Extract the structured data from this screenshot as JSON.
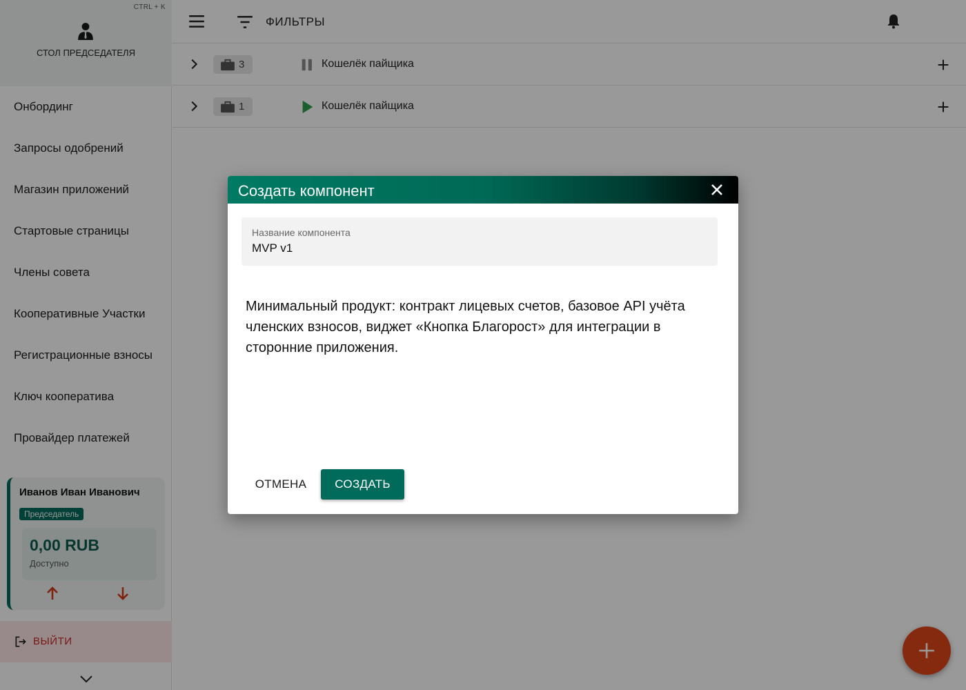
{
  "sidebar": {
    "shortcut": "CTRL + K",
    "title": "СТОЛ ПРЕДСЕДАТЕЛЯ",
    "menu": [
      {
        "label": "Онбординг"
      },
      {
        "label": "Запросы одобрений"
      },
      {
        "label": "Магазин приложений"
      },
      {
        "label": "Стартовые страницы"
      },
      {
        "label": "Члены совета"
      },
      {
        "label": "Кооперативные Участки"
      },
      {
        "label": "Регистрационные взносы"
      },
      {
        "label": "Ключ кооператива"
      },
      {
        "label": "Провайдер платежей"
      }
    ],
    "user": {
      "name": "Иванов Иван Иванович",
      "role": "Председатель",
      "balance": "0,00 RUB",
      "balance_caption": "Доступно"
    },
    "logout": "ВЫЙТИ"
  },
  "topbar": {
    "filters_label": "ФИЛЬТРЫ"
  },
  "rows": [
    {
      "count": "3",
      "status": "paused",
      "label": "Кошелёк пайщика"
    },
    {
      "count": "1",
      "status": "running",
      "label": "Кошелёк пайщика"
    }
  ],
  "dialog": {
    "title": "Создать компонент",
    "name_field": {
      "label": "Название компонента",
      "value": "MVP v1"
    },
    "description": "Минимальный продукт: контракт лицевых счетов, базовое API учёта членских взносов, виджет «Кнопка Благорост» для интеграции в сторонние приложения.",
    "cancel_label": "ОТМЕНА",
    "create_label": "СОЗДАТЬ"
  },
  "colors": {
    "accent": "#006b5a",
    "fab": "#e0461a",
    "logout": "#c62828",
    "running": "#2e9e4a"
  },
  "icons": {
    "avatar": "user-tie-icon",
    "menu": "hamburger-icon",
    "filter": "filter-list-icon",
    "notifications": "bell-icon",
    "theme": "moon-icon",
    "row_expand": "chevron-right-icon",
    "row_chip": "briefcase-icon",
    "row_add": "plus-icon",
    "close": "close-icon",
    "send": "arrow-up-icon",
    "receive": "arrow-down-icon",
    "logout": "logout-icon",
    "collapse": "chevron-down-icon",
    "fab": "plus-icon"
  }
}
